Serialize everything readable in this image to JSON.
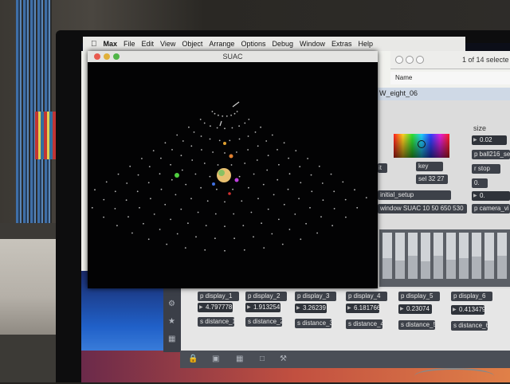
{
  "menubar": {
    "apple": "",
    "app": "Max",
    "items": [
      "File",
      "Edit",
      "View",
      "Object",
      "Arrange",
      "Options",
      "Debug",
      "Window",
      "Extras",
      "Help"
    ]
  },
  "suac_window": {
    "title": "SUAC"
  },
  "browser_window": {
    "count_text": "1 of 14 selecte",
    "name_header": "Name",
    "selected_item": "W_eight_06"
  },
  "patcher": {
    "size_label": "size",
    "size_value": "0.02",
    "ball_object": "p ball216_se",
    "key_object": "key",
    "sel_object": "sel 32 27",
    "r_stop": "r stop",
    "zero_a": "0.",
    "zero_b": "0.",
    "initial_setup": "initial_setup",
    "window_msg": "window SUAC 10 50 650 530",
    "camera_obj": "p camera_vi",
    "it_fragment": "it",
    "displays": [
      "p display_1",
      "p display_2",
      "p display_3",
      "p display_4",
      "p display_5",
      "p display_6"
    ],
    "values": [
      "4.797778",
      "1.913254",
      "3.26239",
      "6.181766",
      "0.23074",
      "0.413479"
    ],
    "distances": [
      "s distance_1",
      "s distance_2",
      "s distance_3",
      "s distance_4",
      "s distance_5",
      "s distance_6"
    ],
    "slider_levels": [
      0.55,
      0.6,
      0.5,
      0.62,
      0.5,
      0.58,
      0.55,
      0.52,
      0.6,
      0.5
    ]
  },
  "colors": {
    "suac_bg": "#030304",
    "accent_orange": "#f0a040"
  }
}
